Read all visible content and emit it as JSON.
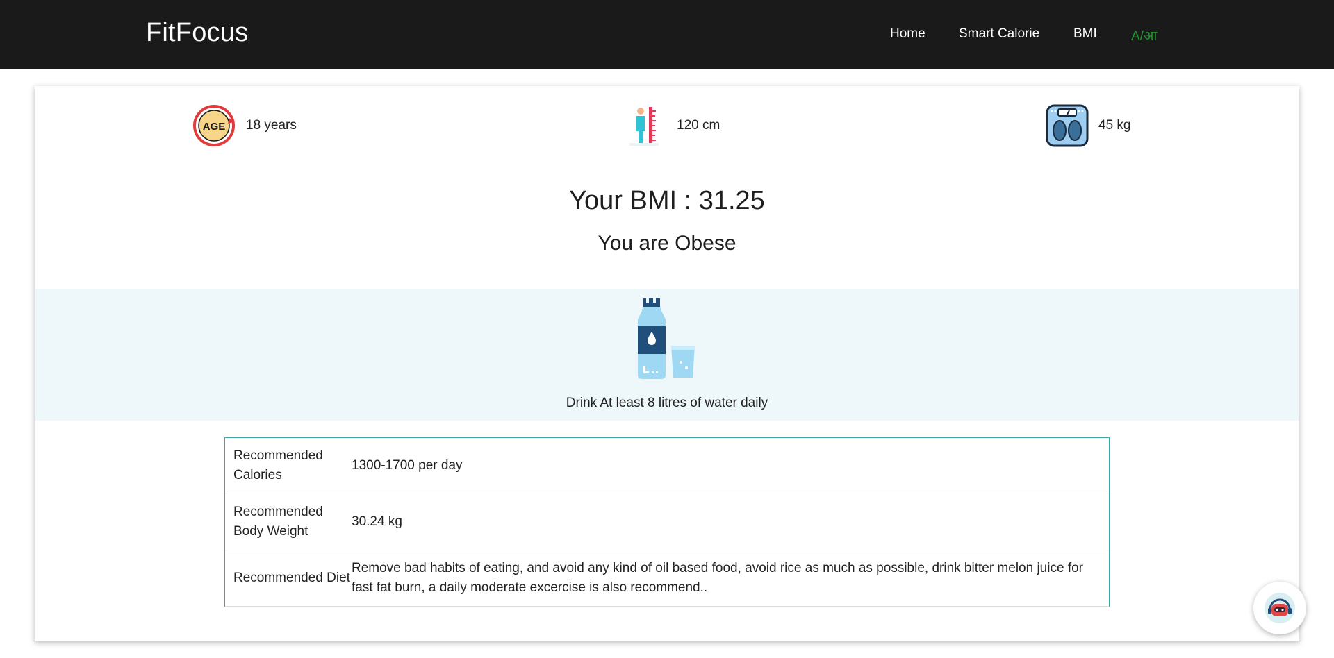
{
  "navbar": {
    "brand": "FitFocus",
    "links": [
      "Home",
      "Smart Calorie",
      "BMI"
    ],
    "language_toggle": "A/आ"
  },
  "stats": {
    "age": {
      "value": "18 years",
      "icon": "age-icon"
    },
    "height": {
      "value": "120 cm",
      "icon": "height-measure-icon"
    },
    "weight": {
      "value": "45 kg",
      "icon": "weighing-scale-icon"
    }
  },
  "result": {
    "bmi_text": "Your BMI : 31.25",
    "status_text": "You are Obese"
  },
  "water": {
    "icon": "water-bottle-icon",
    "text": "Drink At least 8 litres of water daily"
  },
  "recommendations": [
    {
      "label": "Recommended Calories",
      "value": "1300-1700 per day"
    },
    {
      "label": "Recommended Body Weight",
      "value": "30.24 kg"
    },
    {
      "label": "Recommended Diet",
      "value": "Remove bad habits of eating, and avoid any kind of oil based food, avoid rice as much as possible, drink bitter melon juice for fast fat burn, a daily moderate excercise is also recommend.."
    }
  ],
  "chat": {
    "icon": "chatbot-icon"
  },
  "colors": {
    "navbar_bg": "#1b1a1a",
    "language_toggle": "#1a9c2a",
    "water_band_bg": "#eef8fb",
    "table_border": "#3aa9a9"
  }
}
